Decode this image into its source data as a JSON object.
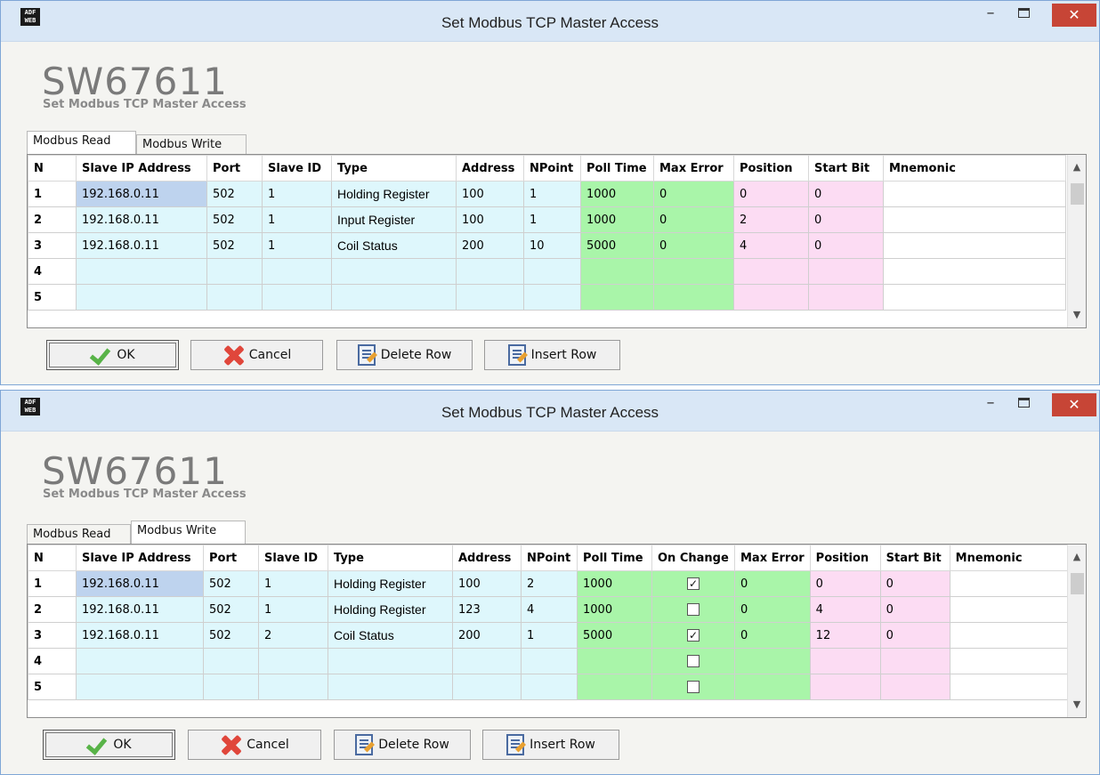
{
  "windows": [
    {
      "title": "Set Modbus TCP Master Access",
      "product": "SW67611",
      "subtitle": "Set Modbus TCP Master Access",
      "tabs": [
        "Modbus Read",
        "Modbus Write"
      ],
      "active_tab": "Modbus Read",
      "columns": [
        "N",
        "Slave IP Address",
        "Port",
        "Slave ID",
        "Type",
        "Address",
        "NPoint",
        "Poll Time",
        "Max Error",
        "Position",
        "Start Bit",
        "Mnemonic"
      ],
      "rows": [
        [
          "1",
          "192.168.0.11",
          "502",
          "1",
          "Holding Register",
          "100",
          "1",
          "1000",
          "0",
          "0",
          "0",
          ""
        ],
        [
          "2",
          "192.168.0.11",
          "502",
          "1",
          "Input Register",
          "100",
          "1",
          "1000",
          "0",
          "2",
          "0",
          ""
        ],
        [
          "3",
          "192.168.0.11",
          "502",
          "1",
          "Coil Status",
          "200",
          "10",
          "5000",
          "0",
          "4",
          "0",
          ""
        ],
        [
          "4",
          "",
          "",
          "",
          "",
          "",
          "",
          "",
          "",
          "",
          "",
          ""
        ],
        [
          "5",
          "",
          "",
          "",
          "",
          "",
          "",
          "",
          "",
          "",
          "",
          ""
        ]
      ],
      "buttons": {
        "ok": "OK",
        "cancel": "Cancel",
        "delete_row": "Delete Row",
        "insert_row": "Insert Row"
      }
    },
    {
      "title": "Set Modbus TCP Master Access",
      "product": "SW67611",
      "subtitle": "Set Modbus TCP Master Access",
      "tabs": [
        "Modbus Read",
        "Modbus Write"
      ],
      "active_tab": "Modbus Write",
      "columns": [
        "N",
        "Slave IP Address",
        "Port",
        "Slave ID",
        "Type",
        "Address",
        "NPoint",
        "Poll Time",
        "On Change",
        "Max Error",
        "Position",
        "Start Bit",
        "Mnemonic"
      ],
      "rows": [
        [
          "1",
          "192.168.0.11",
          "502",
          "1",
          "Holding Register",
          "100",
          "2",
          "1000",
          true,
          "0",
          "0",
          "0",
          ""
        ],
        [
          "2",
          "192.168.0.11",
          "502",
          "1",
          "Holding Register",
          "123",
          "4",
          "1000",
          false,
          "0",
          "4",
          "0",
          ""
        ],
        [
          "3",
          "192.168.0.11",
          "502",
          "2",
          "Coil Status",
          "200",
          "1",
          "5000",
          true,
          "0",
          "12",
          "0",
          ""
        ],
        [
          "4",
          "",
          "",
          "",
          "",
          "",
          "",
          "",
          false,
          "",
          "",
          "",
          ""
        ],
        [
          "5",
          "",
          "",
          "",
          "",
          "",
          "",
          "",
          false,
          "",
          "",
          "",
          ""
        ]
      ],
      "buttons": {
        "ok": "OK",
        "cancel": "Cancel",
        "delete_row": "Delete Row",
        "insert_row": "Insert Row"
      }
    }
  ],
  "colors": {
    "titlebar": "#d9e7f6",
    "close_button": "#c74536",
    "cell_cyan": "#def7fc",
    "cell_green": "#a9f5a9",
    "cell_pink": "#fcdcf3",
    "cell_selected": "#bed3ee"
  },
  "icons": {
    "minimize": "minimize-icon",
    "maximize": "maximize-icon",
    "close": "close-icon",
    "ok": "checkmark-icon",
    "cancel": "red-x-icon",
    "delete_row": "delete-row-icon",
    "insert_row": "insert-row-icon"
  }
}
